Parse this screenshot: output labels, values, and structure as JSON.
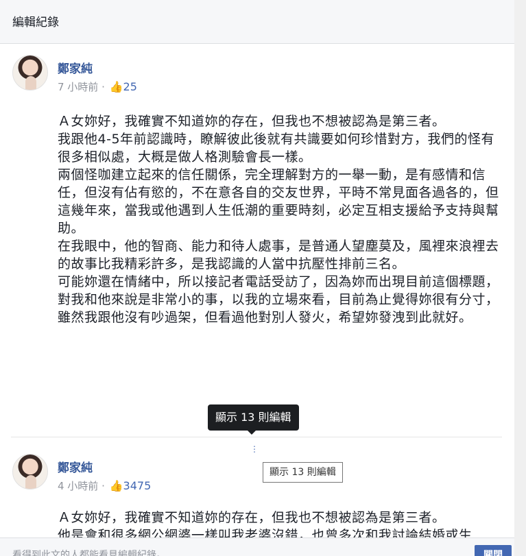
{
  "header": {
    "title": "編輯紀錄",
    "close_glyph": "×"
  },
  "posts": [
    {
      "author": "鄭家純",
      "time": "7 小時前 · ",
      "likes": "25",
      "paragraphs": [
        "Ａ女妳好，我確實不知道妳的存在，但我也不想被認為是第三者。",
        "我跟他4-5年前認識時，瞭解彼此後就有共識要如何珍惜對方，我們的怪有很多相似處，大概是做人格測驗會長一樣。",
        "兩個怪咖建立起來的信任關係，完全理解對方的一舉一動，是有感情和信任，但沒有佔有慾的，不在意各自的交友世界，平時不常見面各過各的，但這幾年來，當我或他遇到人生低潮的重要時刻，必定互相支援給予支持與幫助。",
        "在我眼中，他的智商、能力和待人處事，是普通人望塵莫及，風裡來浪裡去的故事比我精彩許多，是我認識的人當中抗壓性排前三名。",
        "可能妳還在情緒中，所以接記者電話受訪了，因為妳而出現目前這個標題，對我和他來說是非常小的事，以我的立場來看，目前為止覺得妳很有分寸，雖然我跟他沒有吵過架，但看過他對別人發火，希望妳發洩到此就好。"
      ]
    },
    {
      "author": "鄭家純",
      "time": "4 小時前 · ",
      "likes": "3475",
      "paragraphs": [
        "Ａ女妳好，我確實不知道妳的存在，但我也不想被認為是第三者。",
        "他是會和很多網公網婆一樣叫我老婆沒錯，也曾多次和我討論結婚或生"
      ]
    }
  ],
  "edits": {
    "tooltip_dark": "顯示 13 則編輯",
    "dots": "⋮",
    "tooltip_light": "顯示 13 則編輯"
  },
  "footer": {
    "text": "看得到此文的人都能看見編輯紀錄。",
    "close_label": "關閉"
  },
  "icons": {
    "like": "like-icon",
    "close": "close-icon"
  },
  "colors": {
    "link": "#365899",
    "accent": "#4267b2",
    "tooltip_bg": "#1c1e21"
  }
}
